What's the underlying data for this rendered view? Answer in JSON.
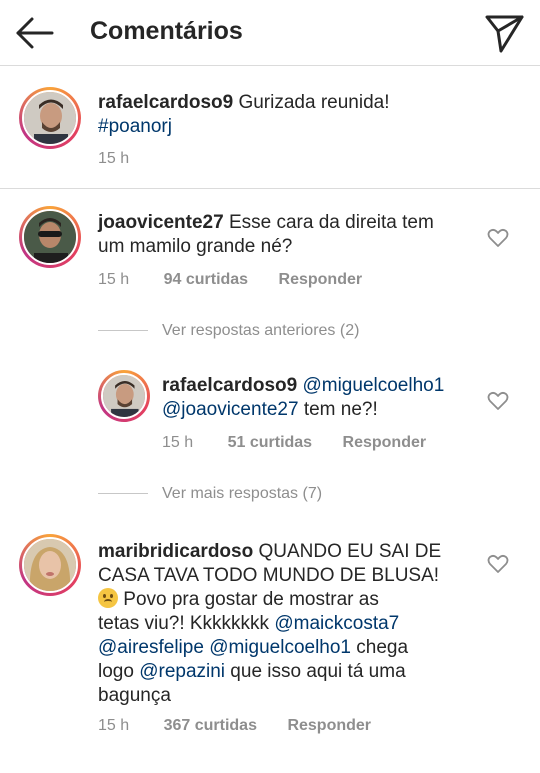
{
  "header": {
    "title": "Comentários",
    "back_icon": "arrow-left-icon",
    "send_icon": "send-direct-icon"
  },
  "caption": {
    "username": "rafaelcardoso9",
    "text": " Gurizada reunida!",
    "hashtag": "#poanorj",
    "time": "15 h"
  },
  "comments": [
    {
      "username": "joaovicente27",
      "line1": " Esse cara da direita tem",
      "line2": "um mamilo grande né?",
      "time": "15 h",
      "likes": "94 curtidas",
      "reply": "Responder"
    },
    {
      "username": "rafaelcardoso9",
      "mention1": "@miguelcoelho1",
      "mention2": "@joaovicente27",
      "text2": " tem ne?!",
      "time": "15 h",
      "likes": "51 curtidas",
      "reply": "Responder"
    },
    {
      "username": "maribridicardoso",
      "line1": " QUANDO EU SAI DE",
      "line2": "CASA TAVA TODO MUNDO DE BLUSA!",
      "line3": " Povo pra gostar de mostrar as",
      "line4": "tetas viu?! Kkkkkkkk ",
      "mention_a": "@maickcosta7",
      "mention_b": "@airesfelipe",
      "mention_c": "@miguelcoelho1",
      "text_c": " chega",
      "line6_pre": "logo ",
      "mention_d": "@repazini",
      "text_d": " que isso aqui tá uma",
      "line7": "bagunça",
      "time": "15 h",
      "likes": "367 curtidas",
      "reply": "Responder"
    }
  ],
  "view_previous": "Ver respostas anteriores (2)",
  "view_more": "Ver mais respostas (7)",
  "colors": {
    "text": "#262626",
    "secondary": "#8e8e8e",
    "mention": "#00376b",
    "divider": "#dbdbdb"
  }
}
